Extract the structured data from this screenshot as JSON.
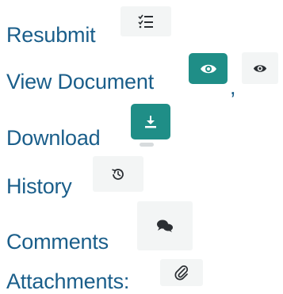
{
  "items": {
    "resubmit": {
      "label": "Resubmit",
      "icon": "checklist-icon"
    },
    "view_document": {
      "label": "View Document",
      "separator": ",",
      "icon_primary": "eye-icon",
      "icon_secondary": "eye-icon"
    },
    "download": {
      "label": "Download",
      "icon": "download-icon"
    },
    "history": {
      "label": "History",
      "icon": "history-icon"
    },
    "comments": {
      "label": "Comments",
      "icon": "comments-icon"
    },
    "attachments": {
      "label": "Attachments:",
      "icon": "paperclip-icon"
    }
  },
  "colors": {
    "text": "#1a5e8a",
    "accent": "#1f8e87",
    "icon_bg": "#f3f5f5",
    "icon_dark": "#2b2f33"
  }
}
